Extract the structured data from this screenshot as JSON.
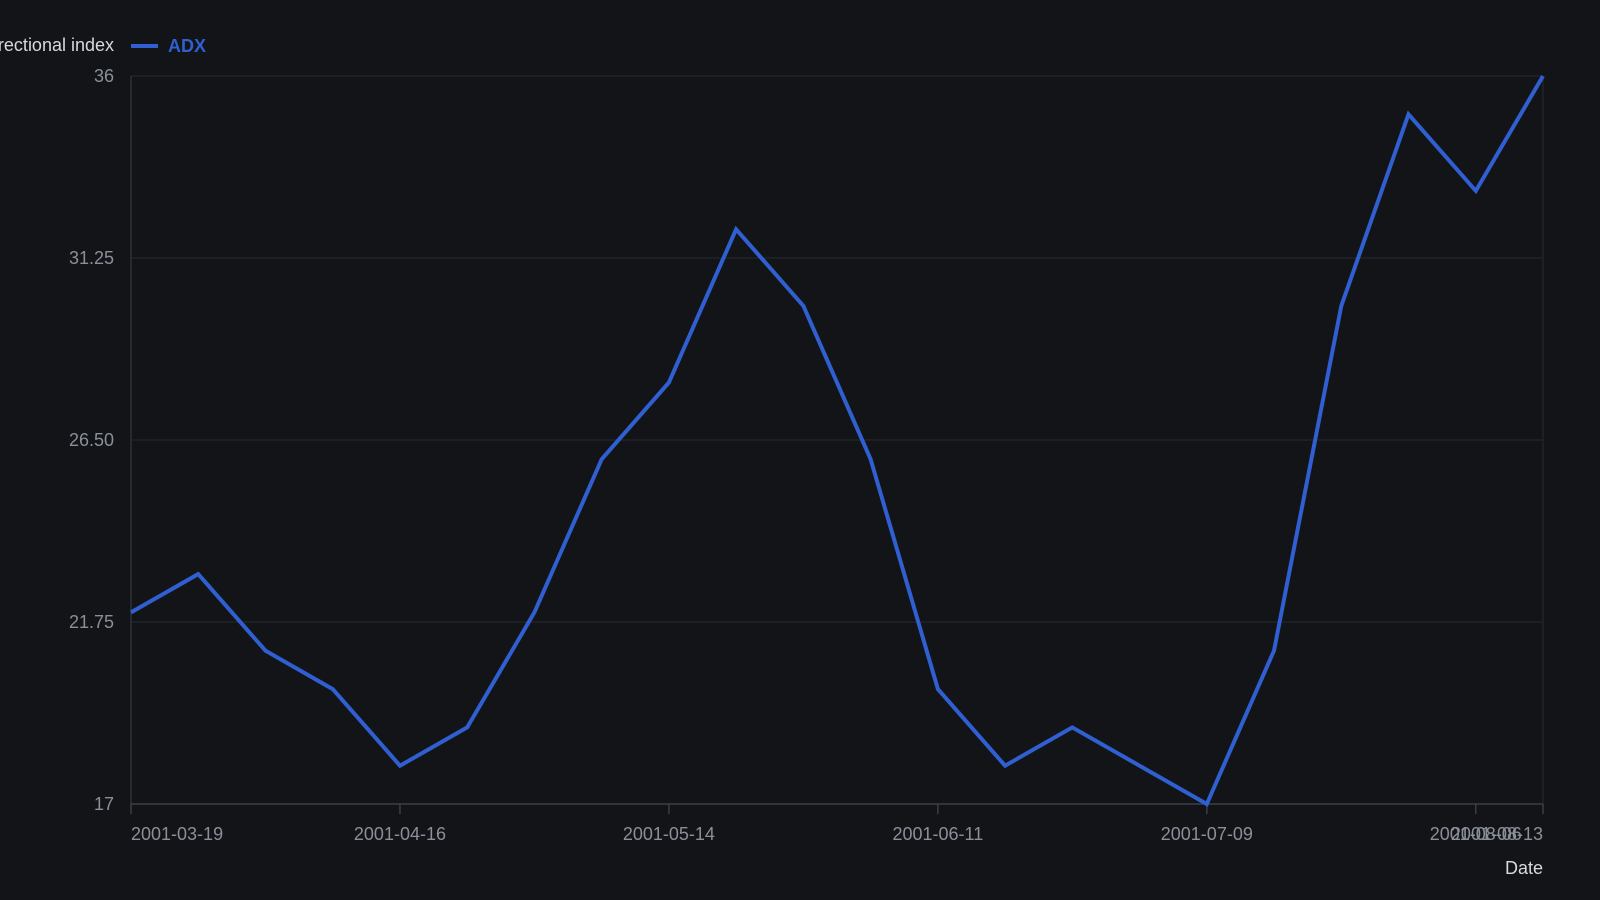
{
  "chart_data": {
    "type": "line",
    "legend_title": "Average directional index",
    "xlabel": "Date",
    "ylabel": "",
    "ylim": [
      17,
      36
    ],
    "y_ticks": [
      "36",
      "31.25",
      "26.50",
      "21.75",
      "17"
    ],
    "x_tick_labels": [
      "2001-03-19",
      "2001-04-16",
      "2001-05-14",
      "2001-06-11",
      "2001-07-09",
      "2001-08-06",
      "2001-08-13"
    ],
    "legend_placement": "top-left",
    "grid": true,
    "series": [
      {
        "name": "ADX",
        "color": "#2f5fd0",
        "x": [
          "2001-03-19",
          "2001-03-26",
          "2001-04-02",
          "2001-04-09",
          "2001-04-16",
          "2001-04-23",
          "2001-04-30",
          "2001-05-07",
          "2001-05-14",
          "2001-05-21",
          "2001-05-28",
          "2001-06-04",
          "2001-06-11",
          "2001-06-18",
          "2001-06-25",
          "2001-07-02",
          "2001-07-09",
          "2001-07-16",
          "2001-07-23",
          "2001-07-30",
          "2001-08-06",
          "2001-08-13"
        ],
        "values": [
          22.0,
          23.0,
          21.0,
          20.0,
          18.0,
          19.0,
          22.0,
          26.0,
          28.0,
          32.0,
          30.0,
          26.0,
          20.0,
          18.0,
          19.0,
          18.0,
          17.0,
          21.0,
          30.0,
          35.0,
          33.0,
          36.0
        ]
      }
    ]
  }
}
